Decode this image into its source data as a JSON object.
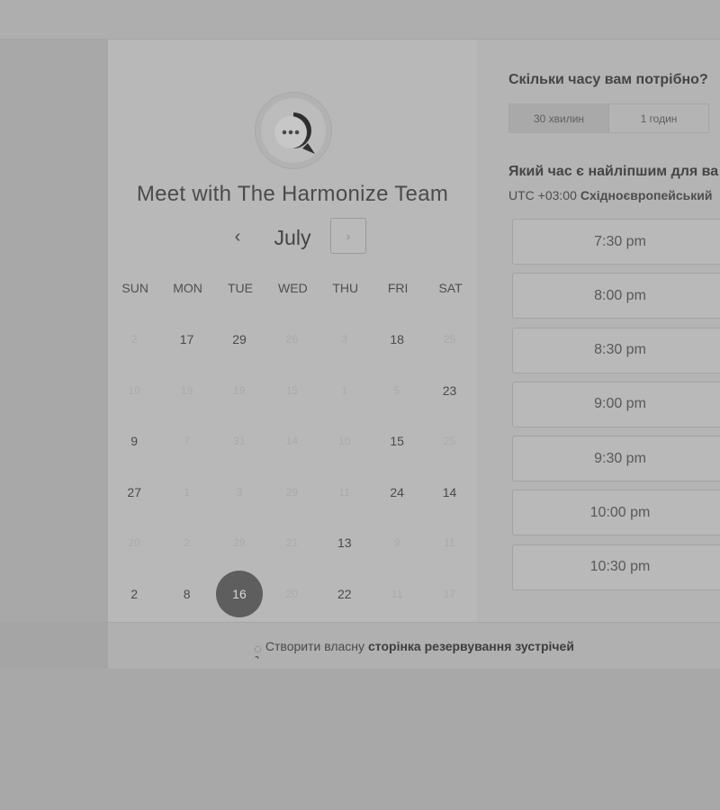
{
  "header": {
    "team_name": "Meet with The Harmonize Team"
  },
  "calendar": {
    "month": "July",
    "prev_icon": "chevron-left-icon",
    "next_icon": "chevron-right-icon",
    "weekdays": [
      "SUN",
      "MON",
      "TUE",
      "WED",
      "THU",
      "FRI",
      "SAT"
    ],
    "weeks": [
      [
        {
          "d": "2",
          "on": false
        },
        {
          "d": "17",
          "on": true
        },
        {
          "d": "29",
          "on": true
        },
        {
          "d": "26",
          "on": false
        },
        {
          "d": "3",
          "on": false
        },
        {
          "d": "18",
          "on": true
        },
        {
          "d": "25",
          "on": false
        }
      ],
      [
        {
          "d": "10",
          "on": false
        },
        {
          "d": "19",
          "on": false
        },
        {
          "d": "19",
          "on": false
        },
        {
          "d": "15",
          "on": false
        },
        {
          "d": "1",
          "on": false
        },
        {
          "d": "5",
          "on": false
        },
        {
          "d": "23",
          "on": true
        }
      ],
      [
        {
          "d": "9",
          "on": true
        },
        {
          "d": "7",
          "on": false
        },
        {
          "d": "31",
          "on": false
        },
        {
          "d": "14",
          "on": false
        },
        {
          "d": "10",
          "on": false
        },
        {
          "d": "15",
          "on": true
        },
        {
          "d": "25",
          "on": false
        }
      ],
      [
        {
          "d": "27",
          "on": true
        },
        {
          "d": "1",
          "on": false
        },
        {
          "d": "3",
          "on": false
        },
        {
          "d": "29",
          "on": false
        },
        {
          "d": "11",
          "on": false
        },
        {
          "d": "24",
          "on": true
        },
        {
          "d": "14",
          "on": true
        }
      ],
      [
        {
          "d": "20",
          "on": false
        },
        {
          "d": "2",
          "on": false
        },
        {
          "d": "29",
          "on": false
        },
        {
          "d": "21",
          "on": false
        },
        {
          "d": "13",
          "on": true
        },
        {
          "d": "9",
          "on": false
        },
        {
          "d": "11",
          "on": false
        }
      ],
      [
        {
          "d": "2",
          "on": true
        },
        {
          "d": "8",
          "on": true
        },
        {
          "d": "16",
          "on": true,
          "selected": true
        },
        {
          "d": "20",
          "on": false
        },
        {
          "d": "22",
          "on": true
        },
        {
          "d": "11",
          "on": false
        },
        {
          "d": "17",
          "on": false
        }
      ]
    ]
  },
  "duration": {
    "title": "Скільки часу вам потрібно?",
    "options": [
      "30 хвилин",
      "1 годин"
    ]
  },
  "times": {
    "title": "Який час є найліпшим для ва",
    "tz_offset": "UTC +03:00",
    "tz_name": "Східноєвропейський",
    "slots": [
      "7:30 pm",
      "8:00 pm",
      "8:30 pm",
      "9:00 pm",
      "9:30 pm",
      "10:00 pm",
      "10:30 pm"
    ]
  },
  "footer": {
    "icon": "hubspot-sprocket-icon",
    "text": "Створити власну",
    "strong": "сторінка резервування зустрічей"
  }
}
